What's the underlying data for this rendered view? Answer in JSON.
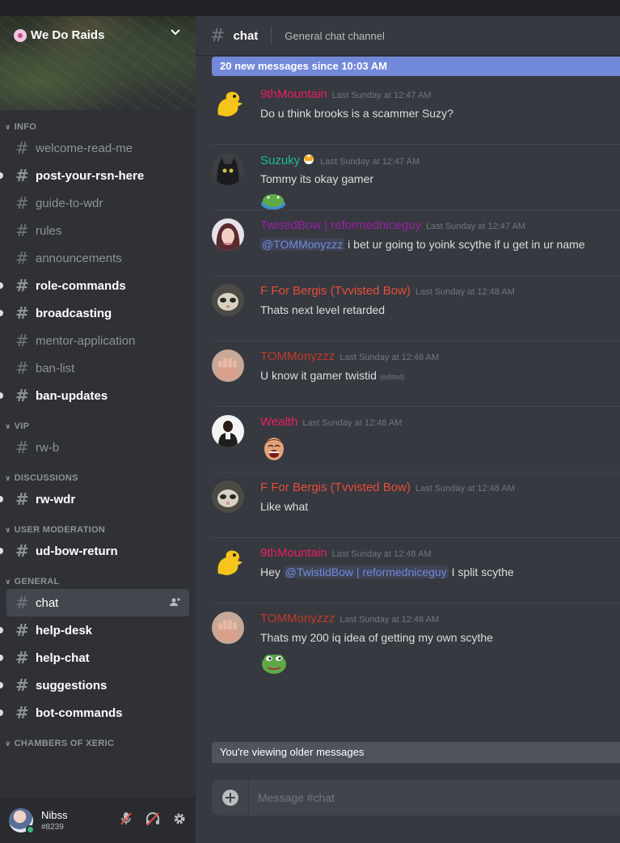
{
  "guild": {
    "name": "We Do Raids"
  },
  "sidebar": {
    "sections": [
      {
        "category": "INFO",
        "channels": [
          {
            "name": "welcome-read-me",
            "unread": false
          },
          {
            "name": "post-your-rsn-here",
            "unread": true
          },
          {
            "name": "guide-to-wdr",
            "unread": false
          },
          {
            "name": "rules",
            "unread": false
          },
          {
            "name": "announcements",
            "unread": false
          },
          {
            "name": "role-commands",
            "unread": true
          },
          {
            "name": "broadcasting",
            "unread": true
          },
          {
            "name": "mentor-application",
            "unread": false
          },
          {
            "name": "ban-list",
            "unread": false
          },
          {
            "name": "ban-updates",
            "unread": true
          }
        ]
      },
      {
        "category": "VIP",
        "channels": [
          {
            "name": "rw-b",
            "unread": false
          }
        ]
      },
      {
        "category": "DISCUSSIONS",
        "channels": [
          {
            "name": "rw-wdr",
            "unread": true
          }
        ]
      },
      {
        "category": "USER MODERATION",
        "channels": [
          {
            "name": "ud-bow-return",
            "unread": true
          }
        ]
      },
      {
        "category": "GENERAL",
        "channels": [
          {
            "name": "chat",
            "unread": false,
            "active": true
          },
          {
            "name": "help-desk",
            "unread": true
          },
          {
            "name": "help-chat",
            "unread": true
          },
          {
            "name": "suggestions",
            "unread": true
          },
          {
            "name": "bot-commands",
            "unread": true
          }
        ]
      },
      {
        "category": "CHAMBERS OF XERIC",
        "channels": []
      }
    ]
  },
  "user": {
    "name": "Nibss",
    "tag": "#8239"
  },
  "header": {
    "channel": "chat",
    "topic": "General chat channel"
  },
  "banner": {
    "new_messages": "20 new messages since 10:03 AM",
    "older": "You're viewing older messages"
  },
  "composer": {
    "placeholder": "Message #chat"
  },
  "messages": [
    {
      "author": "9thMountain",
      "color": "#e91e63",
      "avatar": "duck",
      "timestamp": "Last Sunday at 12:47 AM",
      "body": [
        {
          "t": "Do u think brooks is a scammer Suzy?"
        }
      ],
      "emoji": null
    },
    {
      "author": "Suzuky",
      "color": "#1abc9c",
      "avatar": "cat",
      "badge": true,
      "timestamp": "Last Sunday at 12:47 AM",
      "body": [
        {
          "t": "Tommy its okay gamer"
        }
      ],
      "emoji": "frog-flat"
    },
    {
      "author": "TwistidBow | reformedniceguy",
      "color": "#9b1fa8",
      "avatar": "girl",
      "timestamp": "Last Sunday at 12:47 AM",
      "body": [
        {
          "m": "@TOMMonyzzz"
        },
        {
          "t": " i bet ur going to yoink scythe if u get in ur name"
        }
      ],
      "emoji": null
    },
    {
      "author": "F For Bergis (Tvvisted Bow)",
      "color": "#e74c3c",
      "avatar": "ferret",
      "timestamp": "Last Sunday at 12:48 AM",
      "body": [
        {
          "t": "Thats next level retarded"
        }
      ],
      "emoji": null
    },
    {
      "author": "TOMMonyzzz",
      "color": "#c0392b",
      "avatar": "hand",
      "timestamp": "Last Sunday at 12:48 AM",
      "body": [
        {
          "t": "U know it gamer twistid"
        }
      ],
      "edited": "(edited)",
      "emoji": null
    },
    {
      "author": "Wealth",
      "color": "#e91e63",
      "avatar": "man",
      "timestamp": "Last Sunday at 12:48 AM",
      "body": [],
      "emoji": "laugh-face"
    },
    {
      "author": "F For Bergis (Tvvisted Bow)",
      "color": "#e74c3c",
      "avatar": "ferret",
      "timestamp": "Last Sunday at 12:48 AM",
      "body": [
        {
          "t": "Like what"
        }
      ],
      "emoji": null
    },
    {
      "author": "9thMountain",
      "color": "#e91e63",
      "avatar": "duck",
      "timestamp": "Last Sunday at 12:48 AM",
      "body": [
        {
          "t": "Hey "
        },
        {
          "m": "@TwistidBow | reformedniceguy"
        },
        {
          "t": " I split scythe"
        }
      ],
      "emoji": null
    },
    {
      "author": "TOMMonyzzz",
      "color": "#c0392b",
      "avatar": "hand",
      "timestamp": "Last Sunday at 12:48 AM",
      "body": [
        {
          "t": "Thats my 200 iq idea of getting my own scythe"
        }
      ],
      "emoji": "frog-round"
    }
  ]
}
